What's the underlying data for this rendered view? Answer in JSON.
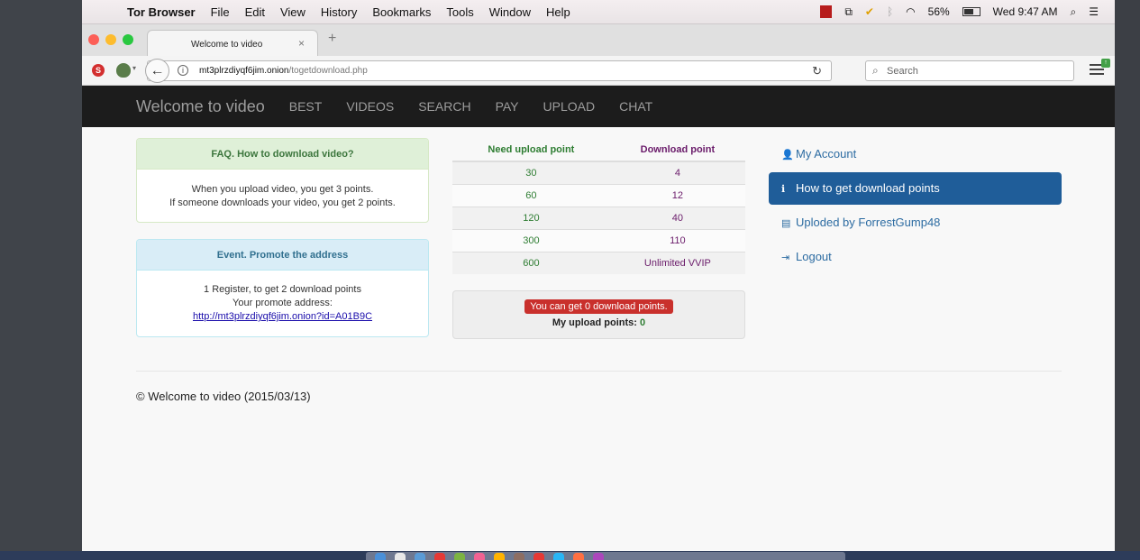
{
  "menubar": {
    "app_name": "Tor Browser",
    "items": [
      "File",
      "Edit",
      "View",
      "History",
      "Bookmarks",
      "Tools",
      "Window",
      "Help"
    ],
    "battery": "56%",
    "clock": "Wed 9:47 AM"
  },
  "tab": {
    "title": "Welcome to video",
    "close": "×",
    "new": "+"
  },
  "urlbar": {
    "domain": "mt3plrzdiyqf6jim.onion",
    "path": "/togetdownload.php",
    "search_placeholder": "Search"
  },
  "site": {
    "brand": "Welcome to video",
    "nav": [
      "BEST",
      "VIDEOS",
      "SEARCH",
      "PAY",
      "UPLOAD",
      "CHAT"
    ]
  },
  "faq": {
    "title": "FAQ. How to download video?",
    "line1": "When you upload video, you get 3 points.",
    "line2": "If someone downloads your video, you get 2 points."
  },
  "event": {
    "title": "Event. Promote the address",
    "line1": "1 Register, to get 2 download points",
    "line2": "Your promote address:",
    "link": "http://mt3plrzdiyqf6jim.onion?id=A01B9C"
  },
  "points_table": {
    "headers": [
      "Need upload point",
      "Download point"
    ],
    "rows": [
      [
        "30",
        "4"
      ],
      [
        "60",
        "12"
      ],
      [
        "120",
        "40"
      ],
      [
        "300",
        "110"
      ],
      [
        "600",
        "Unlimited VVIP"
      ]
    ]
  },
  "status": {
    "alert": "You can get 0 download points.",
    "upload_label": "My upload points:",
    "upload_value": "0"
  },
  "sidebar": {
    "items": [
      {
        "label": "My Account",
        "icon": "user-icon",
        "glyph": "👤"
      },
      {
        "label": "How to get download points",
        "icon": "info-circle-icon",
        "glyph": "ℹ"
      },
      {
        "label": "Uploded by ForrestGump48",
        "icon": "list-icon",
        "glyph": "▤"
      },
      {
        "label": "Logout",
        "icon": "logout-icon",
        "glyph": "⇥"
      }
    ]
  },
  "footer": {
    "text": "© Welcome to video (2015/03/13)"
  },
  "colors": {
    "navbar_bg": "#1c1c1c",
    "active_bg": "#1f5d99",
    "alert_bg": "#c9302c",
    "upload_green": "#2e7d32",
    "download_purple": "#6a1b6a"
  }
}
